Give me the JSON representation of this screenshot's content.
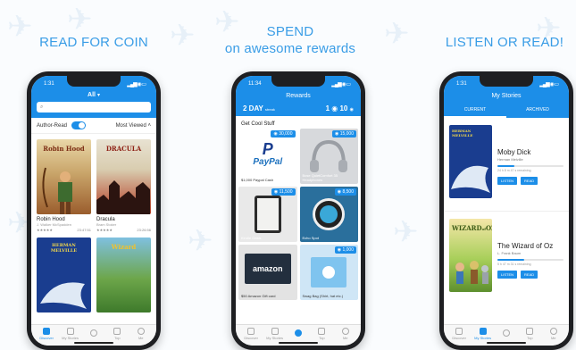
{
  "captions": {
    "left": "READ FOR COIN",
    "center_line1": "SPEND",
    "center_line2": "on awesome rewards",
    "right": "LISTEN OR READ!"
  },
  "colors": {
    "accent": "#1c8ee8",
    "caption": "#3a9de6"
  },
  "phone1": {
    "time": "1:31",
    "title": "All",
    "search_placeholder": "",
    "filter_label": "Author-Read",
    "sort_label": "Most Viewed",
    "books": [
      {
        "cover_text": "Robin Hood",
        "title": "Robin Hood",
        "author": "J. Walker McSpadden",
        "views": "23:47:51"
      },
      {
        "cover_text": "DRACULA",
        "title": "Dracula",
        "author": "Bram Stoker",
        "views": "23:26:56"
      },
      {
        "cover_text": "HERMAN MELVILLE",
        "title": "",
        "author": "",
        "views": ""
      },
      {
        "cover_text": "Wizard",
        "title": "",
        "author": "",
        "views": ""
      }
    ]
  },
  "phone2": {
    "time": "11:34",
    "title": "Rewards",
    "streak": "2 DAY",
    "streak_sub": "streak",
    "coins_prefix": "1",
    "coins": "10",
    "section": "Get Cool Stuff",
    "rewards": [
      {
        "cost": "30,000",
        "name": "$1,000 Paypal Cash",
        "brand": "PayPal"
      },
      {
        "cost": "15,000",
        "name": "Bose QuietComfort 35 Headphones",
        "brand": ""
      },
      {
        "cost": "11,500",
        "name": "Kindle Oasis",
        "brand": ""
      },
      {
        "cost": "8,500",
        "name": "Echo Spot",
        "brand": ""
      },
      {
        "cost": "",
        "name": "$50 Amazon Gift card",
        "brand": "amazon"
      },
      {
        "cost": "1,000",
        "name": "Swag Bag (Shirt, hat etc.)",
        "brand": ""
      }
    ]
  },
  "phone3": {
    "time": "1:31",
    "title": "My Stories",
    "tab_current": "CURRENT",
    "tab_archived": "ARCHIVED",
    "stories": [
      {
        "title": "Moby Dick",
        "author": "Herman Melville",
        "remaining": "24 h 8 m 47 s remaining",
        "progress": 0.25,
        "listen": "LISTEN",
        "read": "READ"
      },
      {
        "title": "The Wizard of Oz",
        "author": "L. Frank Baum",
        "remaining": "5 h 47 m 31 s remaining",
        "progress": 0.4,
        "listen": "LISTEN",
        "read": "READ"
      }
    ]
  },
  "tabbar": [
    "Discover",
    "My Stories",
    "",
    "Top",
    "Me"
  ]
}
